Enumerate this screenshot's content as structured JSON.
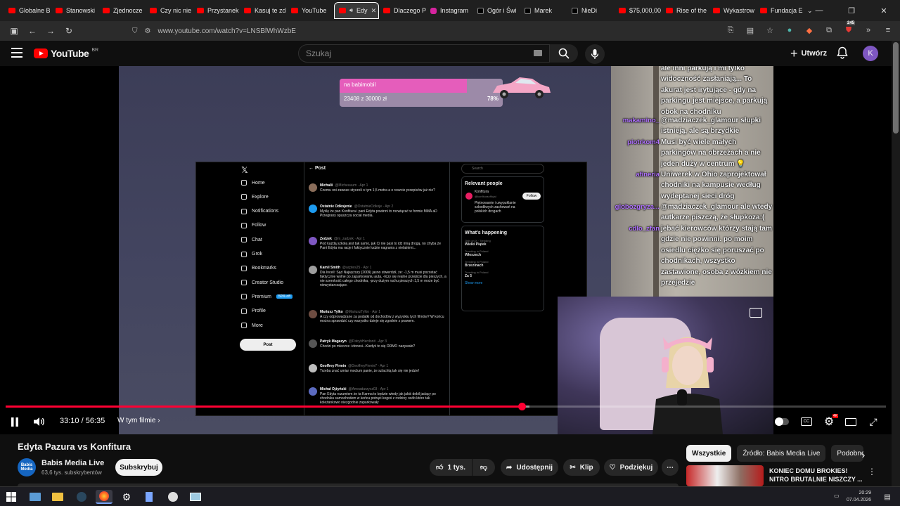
{
  "browser": {
    "tabs": [
      {
        "label": "Globalne B",
        "icon": "youtube-icon"
      },
      {
        "label": "Stanowski",
        "icon": "youtube-icon"
      },
      {
        "label": "Zjednocze",
        "icon": "youtube-icon"
      },
      {
        "label": "Czy nic nie",
        "icon": "youtube-icon"
      },
      {
        "label": "Przystanek",
        "icon": "youtube-icon"
      },
      {
        "label": "Kasuj te zd",
        "icon": "youtube-icon"
      },
      {
        "label": "YouTube",
        "icon": "youtube-icon"
      },
      {
        "label": "Edy",
        "icon": "youtube-icon",
        "active": true
      },
      {
        "label": "Dlaczego P",
        "icon": "youtube-icon"
      },
      {
        "label": "Instagram",
        "icon": "instagram-icon"
      },
      {
        "label": "Ogór i Świ",
        "icon": "x-icon"
      },
      {
        "label": "Marek",
        "icon": "x-icon"
      },
      {
        "label": "NieDi",
        "icon": "x-icon"
      },
      {
        "label": "$75,000,00",
        "icon": "youtube-icon"
      },
      {
        "label": "Rise of the",
        "icon": "youtube-icon"
      },
      {
        "label": "Wykastrow",
        "icon": "youtube-icon"
      },
      {
        "label": "Fundacja E",
        "icon": "youtube-icon"
      }
    ],
    "url": "www.youtube.com/watch?v=LNSBlWhWzbE",
    "extension_badge": "245"
  },
  "youtube": {
    "logo_text": "YouTube",
    "country_code": "BR",
    "search_placeholder": "Szukaj",
    "create_label": "Utwórz",
    "avatar_letter": "K"
  },
  "stream": {
    "goal_label": "na babimobil",
    "goal_amount": "23408  z  30000  zł",
    "goal_percent": "78%",
    "goal_fraction": 0.78,
    "x_post_header": "Post",
    "x_nav": [
      "Home",
      "Explore",
      "Notifications",
      "Follow",
      "Chat",
      "Grok",
      "Bookmarks",
      "Creator Studio",
      "Premium",
      "Profile",
      "More"
    ],
    "x_premium_badge": "50% off",
    "x_post_button": "Post",
    "x_tweets": [
      {
        "name": "Michalii",
        "handle": "@Micheuuum · Apr 1",
        "text": "Czemu oni zawsze styczeli o tym 1,5 metra a o reszcie przepisów już nie?"
      },
      {
        "name": "Ostatnie Odkojenie",
        "handle": "@OstatnieOdkoje · Apr 2",
        "text": "Myślę że pan Konfitura i pani Edyta powinni to rozwiązać w formie MMA aD Przegrany opuszcza social media."
      },
      {
        "name": "Zedzek",
        "handle": "@m_zadzek · Apr 1",
        "text": "Pod każdą szkołą jest tak samo, jak Ci nie pasi to idź inną drogą, no chyba że Pani Edyta ma racje i faktycznie ludzie nagrania z nielatnimi..."
      },
      {
        "name": "Kamil Smith",
        "handle": "@acptes25 · Apr 1",
        "text": "Dla Incell: Sąd Najwyższy (2009) jasno stwierdził, że: -1,5 m musi pozostać faktycznie wolne po zaparkowaniu auta, -liczy się realne przejście dla pieszych, a nie szerokość całego chodnika, -przy dużym ruchu pieszych 1,5 m może być niewystarczające."
      },
      {
        "name": "Mariusz Tylko",
        "handle": "@MariuszTylko · Apr 1",
        "text": "A czy odprowadzane za podatki od dochodów z wyzyskiu tych filmów? W końcu można sprawdzić czy wszystko dzieje się zgodnie z prawem."
      },
      {
        "name": "Patryk Magazyn",
        "handle": "@PatrykHerdonit · Apr 3",
        "text": "Chodzi po mleczce i donosi...Kiedyś to się ORMO nazywało?"
      },
      {
        "name": "Geoffrey Firmin",
        "handle": "@GeoffreyFirmin7 · Apr 1",
        "text": "Trzeba znać umiar moclum panie, że szlachtą tak się nie jedzie!"
      },
      {
        "name": "Michał Ojżyński",
        "handle": "@Ameadurzycz03 · Apr 1",
        "text": "Pan Edyta rozumiem że ta Karma to będzie wtedy jak jakiś debil jadący po chodniku samochodem w końcu potrąci kogoś z rodziny osób które tak koleżankowo niezgodnie zaparkowały"
      }
    ],
    "x_search_placeholder": "Search",
    "x_relevant_title": "Relevant people",
    "x_relevant": {
      "name": "Konfitura",
      "handle": "@konfituraofficjal",
      "bio": "Piętnowanie i uwypuklanie szkodliwych zachowań na polskich drogach",
      "follow": "Follow"
    },
    "x_happening_title": "What's happening",
    "x_trends": [
      {
        "meta": "Only on X · Trending",
        "name": "Wielki Piątek"
      },
      {
        "meta": "Trending in Poland",
        "name": "Włoszech"
      },
      {
        "meta": "Trending in Poland",
        "name": "Brzezinach"
      },
      {
        "meta": "Trending in Poland",
        "name": "Za 5"
      }
    ],
    "x_show_more": "Show more",
    "chat": [
      {
        "user": "",
        "message": "ale inni parkują i mi tylko widoczność zasłaniają... To akurat jest irytujące - gdy na parkingu jest miejsce, a parkują obok na chodniku"
      },
      {
        "user": "makamino_",
        "message": "@madziaczek_glamour słupki istnieją, ale są brzydkie"
      },
      {
        "user": "piotrkom4",
        "message": "Musi być wiele małych parkingów na obrzeżach a nie jeden duży w centrum 💡"
      },
      {
        "user": "afineria",
        "message": "Uniwerek w Ohio zaprojektował chodniki na kampusie według wydeptanej sieci dróg"
      },
      {
        "user": "globozgryza...",
        "message": "@madziaczek_glamour ale wtedy autkarze piszczą, że słupkoza:("
      },
      {
        "user": "cdlo_zfan",
        "message": "jebać kierowców którzy stają tam gdzie nie powinni. po moim osiedlu ciężko się poruszać po chodnikach, wszystko zastawione, osoba z wózkiem nie przejedzie"
      }
    ]
  },
  "player": {
    "time": "33:10 / 56:35",
    "played_fraction": 0.586,
    "buffered_fraction": 0.595,
    "chapter_label": "W tym filmie"
  },
  "video": {
    "title": "Edyta Pazura vs Konfitura",
    "channel_name": "Babis Media Live",
    "channel_avatar_text": "Babis Media",
    "subscribers": "63,6 tys. subskrybentów",
    "subscribe_label": "Subskrybuj",
    "likes": "1 tys.",
    "share_label": "Udostępnij",
    "clip_label": "Klip",
    "thanks_label": "Podziękuj"
  },
  "recommendations": {
    "chips": [
      "Wszystkie",
      "Źródło: Babis Media Live",
      "Podobne"
    ],
    "first_title": "KONIEC DOMU BROKIES! NITRO BRUTALNIE NISZCZY ..."
  },
  "taskbar": {
    "time": "20:29",
    "date": "07.04.2026"
  },
  "colors": {
    "accent": "#ff0033",
    "youtube_red": "#ff0000",
    "chat_username": "#b071ff",
    "goal_fill": "#e55dbb"
  }
}
